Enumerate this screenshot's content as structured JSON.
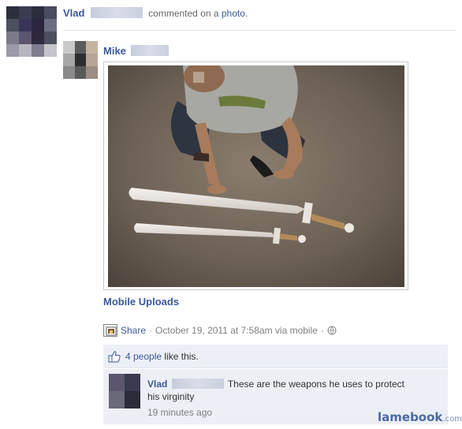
{
  "story": {
    "actor_name": "Vlad",
    "action_text": "commented on a photo.",
    "action_link": "photo"
  },
  "post": {
    "author_name": "Mike",
    "album_link": "Mobile Uploads",
    "share_label": "Share",
    "meta_text": "October 19, 2011 at 7:58am via mobile",
    "separator": "·"
  },
  "likes": {
    "text": "4 people",
    "suffix": "like this."
  },
  "comment": {
    "author_name": "Vlad",
    "text": "These are the weapons he uses to protect his virginity",
    "time": "19 minutes ago"
  },
  "watermark": {
    "brand": "lamebook",
    "tld": ".com"
  },
  "colors": {
    "link_blue": "#3b5998",
    "meta_grey": "#808080",
    "like_box_bg": "#eceff5",
    "brand_blue": "#4a6aa5"
  },
  "icons": {
    "share": "share-icon",
    "globe": "globe-icon",
    "like": "thumbs-up-icon"
  }
}
